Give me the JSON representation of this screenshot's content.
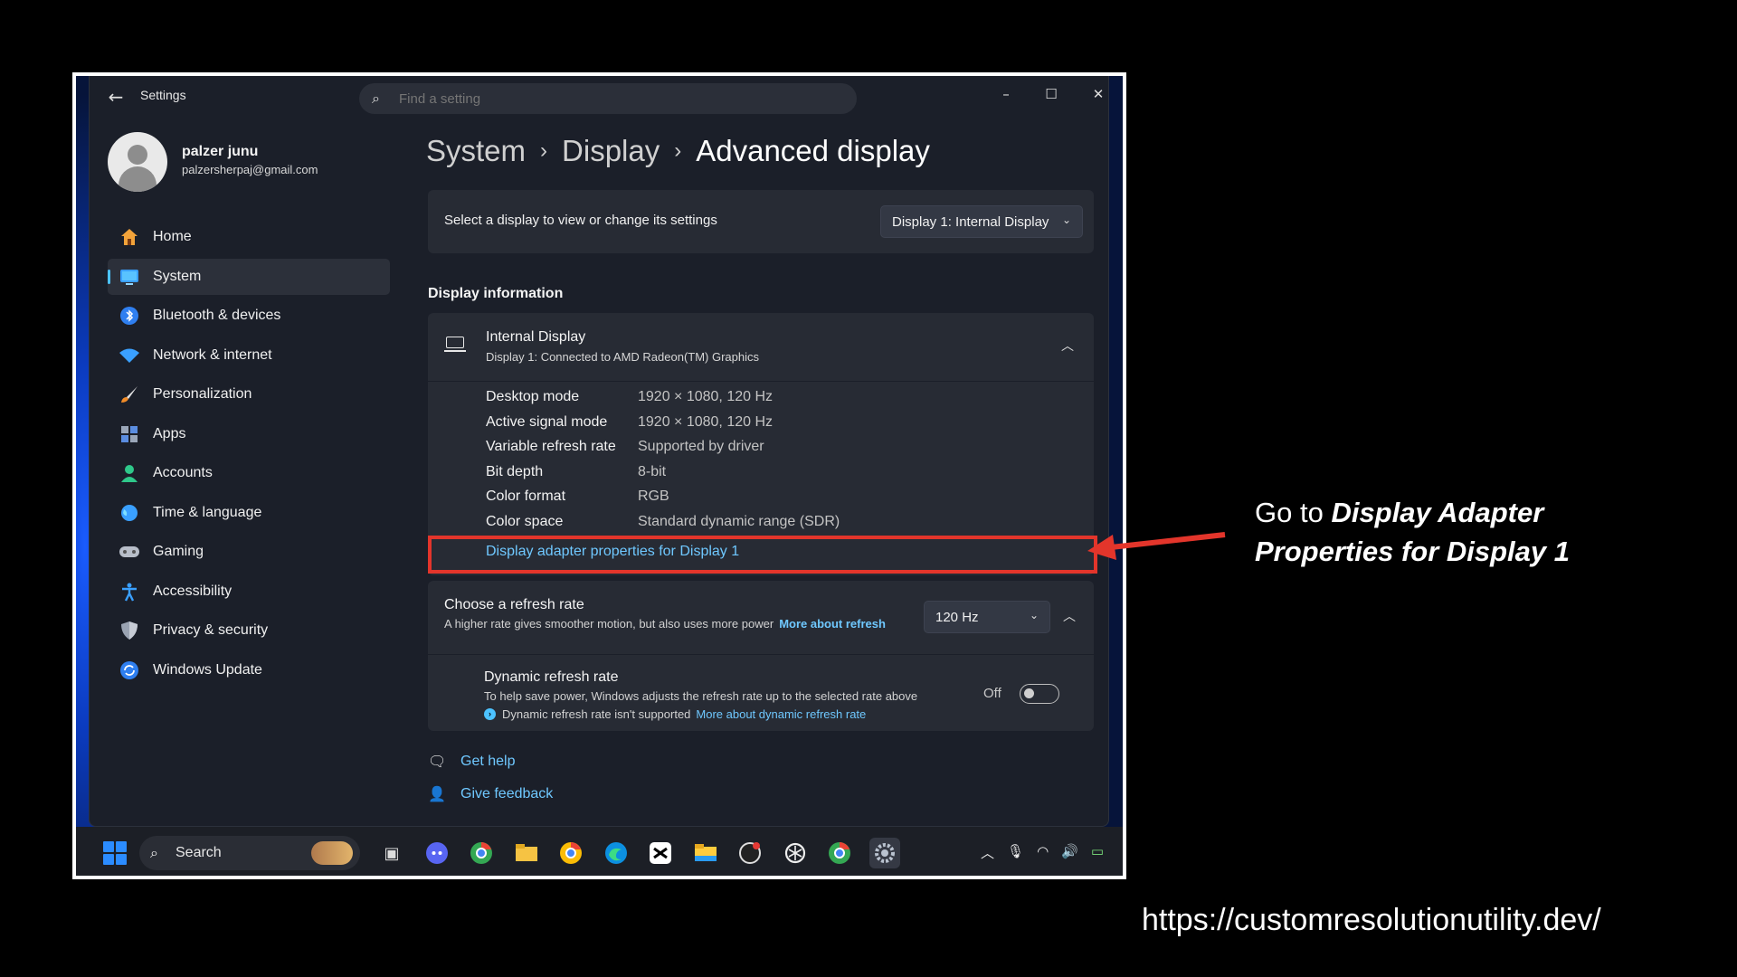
{
  "window": {
    "title": "Settings",
    "search_placeholder": "Find a setting"
  },
  "profile": {
    "name": "palzer junu",
    "email": "palzersherpaj@gmail.com"
  },
  "sidebar": {
    "items": [
      {
        "label": "Home",
        "icon": "home-icon"
      },
      {
        "label": "System",
        "icon": "system-icon",
        "active": true
      },
      {
        "label": "Bluetooth & devices",
        "icon": "bluetooth-icon"
      },
      {
        "label": "Network & internet",
        "icon": "wifi-icon"
      },
      {
        "label": "Personalization",
        "icon": "brush-icon"
      },
      {
        "label": "Apps",
        "icon": "apps-icon"
      },
      {
        "label": "Accounts",
        "icon": "accounts-icon"
      },
      {
        "label": "Time & language",
        "icon": "globe-icon"
      },
      {
        "label": "Gaming",
        "icon": "gamepad-icon"
      },
      {
        "label": "Accessibility",
        "icon": "accessibility-icon"
      },
      {
        "label": "Privacy & security",
        "icon": "shield-icon"
      },
      {
        "label": "Windows Update",
        "icon": "update-icon"
      }
    ]
  },
  "breadcrumb": {
    "level1": "System",
    "level2": "Display",
    "current": "Advanced display"
  },
  "display_select": {
    "label": "Select a display to view or change its settings",
    "value": "Display 1: Internal Display"
  },
  "display_info": {
    "section_title": "Display information",
    "device_title": "Internal Display",
    "device_subtitle": "Display 1: Connected to AMD Radeon(TM) Graphics",
    "rows": [
      {
        "key": "Desktop mode",
        "value": "1920 × 1080, 120 Hz"
      },
      {
        "key": "Active signal mode",
        "value": "1920 × 1080, 120 Hz"
      },
      {
        "key": "Variable refresh rate",
        "value": "Supported by driver"
      },
      {
        "key": "Bit depth",
        "value": "8-bit"
      },
      {
        "key": "Color format",
        "value": "RGB"
      },
      {
        "key": "Color space",
        "value": "Standard dynamic range (SDR)"
      }
    ],
    "adapter_link": "Display adapter properties for Display 1"
  },
  "refresh_rate": {
    "title": "Choose a refresh rate",
    "subtitle": "A higher rate gives smoother motion, but also uses more power",
    "link": "More about refresh",
    "value": "120 Hz"
  },
  "dynamic_refresh": {
    "title": "Dynamic refresh rate",
    "subtitle": "To help save power, Windows adjusts the refresh rate up to the selected rate above",
    "note": "Dynamic refresh rate isn't supported",
    "note_link": "More about dynamic refresh rate",
    "toggle_label": "Off"
  },
  "help": {
    "get_help": "Get help",
    "give_feedback": "Give feedback"
  },
  "taskbar": {
    "search_label": "Search"
  },
  "annotation": {
    "prefix": "Go to ",
    "emphasis": "Display Adapter Properties for Display 1",
    "arrow_color": "#e3352b"
  },
  "footer": {
    "url": "https://customresolutionutility.dev/"
  },
  "colors": {
    "accent": "#4cc2ff",
    "link": "#6fc8ff",
    "highlight": "#e3352b"
  }
}
